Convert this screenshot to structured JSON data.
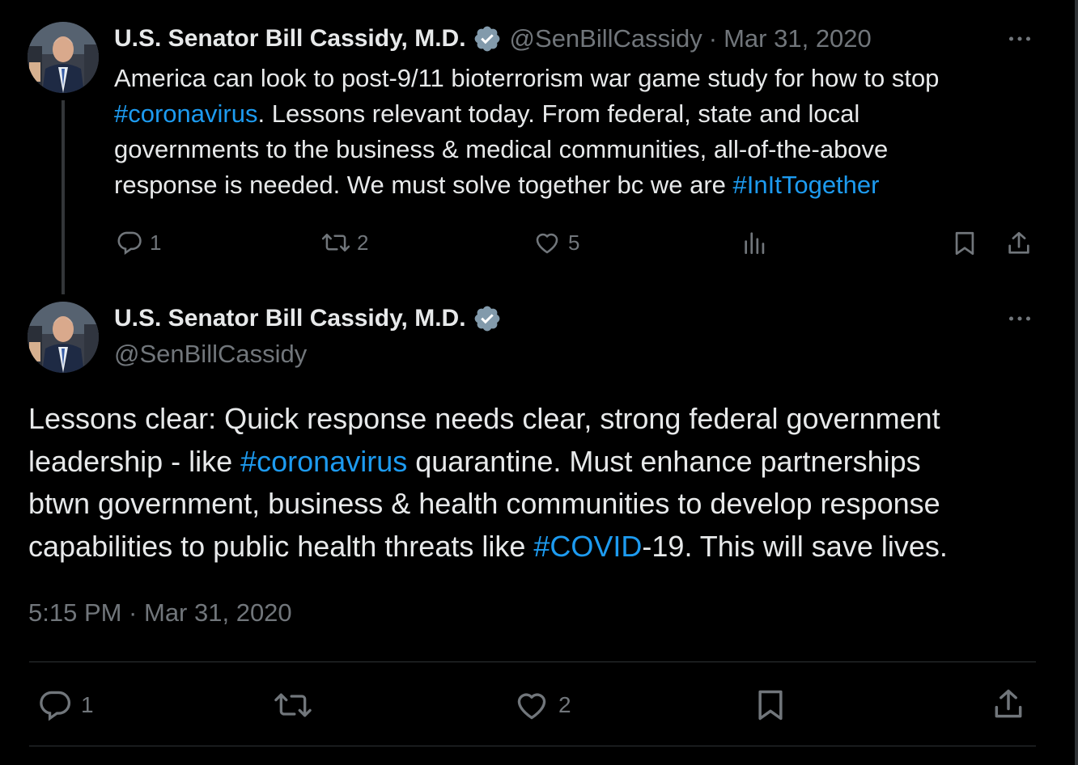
{
  "tweet1": {
    "author_name": "U.S. Senator Bill Cassidy, M.D.",
    "handle": "@SenBillCassidy",
    "separator": "·",
    "date": "Mar 31, 2020",
    "body_lines": [
      {
        "pre": "America can look to post-9/11 bioterrorism war game study for how to stop",
        "tag": "",
        "post": ""
      },
      {
        "pre": "",
        "tag": "#coronavirus",
        "post": ". Lessons relevant today. From federal, state and local"
      },
      {
        "pre": "governments to the business & medical communities, all-of-the-above",
        "tag": "",
        "post": ""
      },
      {
        "pre": "response is needed. We must solve together bc we are ",
        "tag": "#InItTogether",
        "post": ""
      }
    ],
    "actions": {
      "reply_count": "1",
      "retweet_count": "2",
      "like_count": "5"
    }
  },
  "tweet2": {
    "author_name": "U.S. Senator Bill Cassidy, M.D.",
    "handle": "@SenBillCassidy",
    "body_lines": [
      {
        "pre": "Lessons clear: Quick response needs clear, strong federal government",
        "tag": "",
        "post": ""
      },
      {
        "pre": "leadership - like ",
        "tag": "#coronavirus",
        "post": " quarantine. Must enhance partnerships"
      },
      {
        "pre": "btwn government, business & health communities to develop response",
        "tag": "",
        "post": ""
      },
      {
        "pre": "capabilities to public health threats like ",
        "tag": "#COVID",
        "post": "-19. This will save lives."
      }
    ],
    "timestamp": "5:15 PM · Mar 31, 2020",
    "actions": {
      "reply_count": "1",
      "like_count": "2"
    }
  },
  "colors": {
    "background": "#000000",
    "text": "#e7e9ea",
    "muted": "#71767b",
    "link": "#1d9bf0",
    "verified": "#829aab",
    "divider": "#2f3336"
  },
  "icons": {
    "verified": "verified-badge-icon",
    "reply": "reply-icon",
    "retweet": "retweet-icon",
    "like": "heart-icon",
    "views": "views-icon",
    "bookmark": "bookmark-icon",
    "share": "share-icon",
    "more": "more-icon"
  }
}
